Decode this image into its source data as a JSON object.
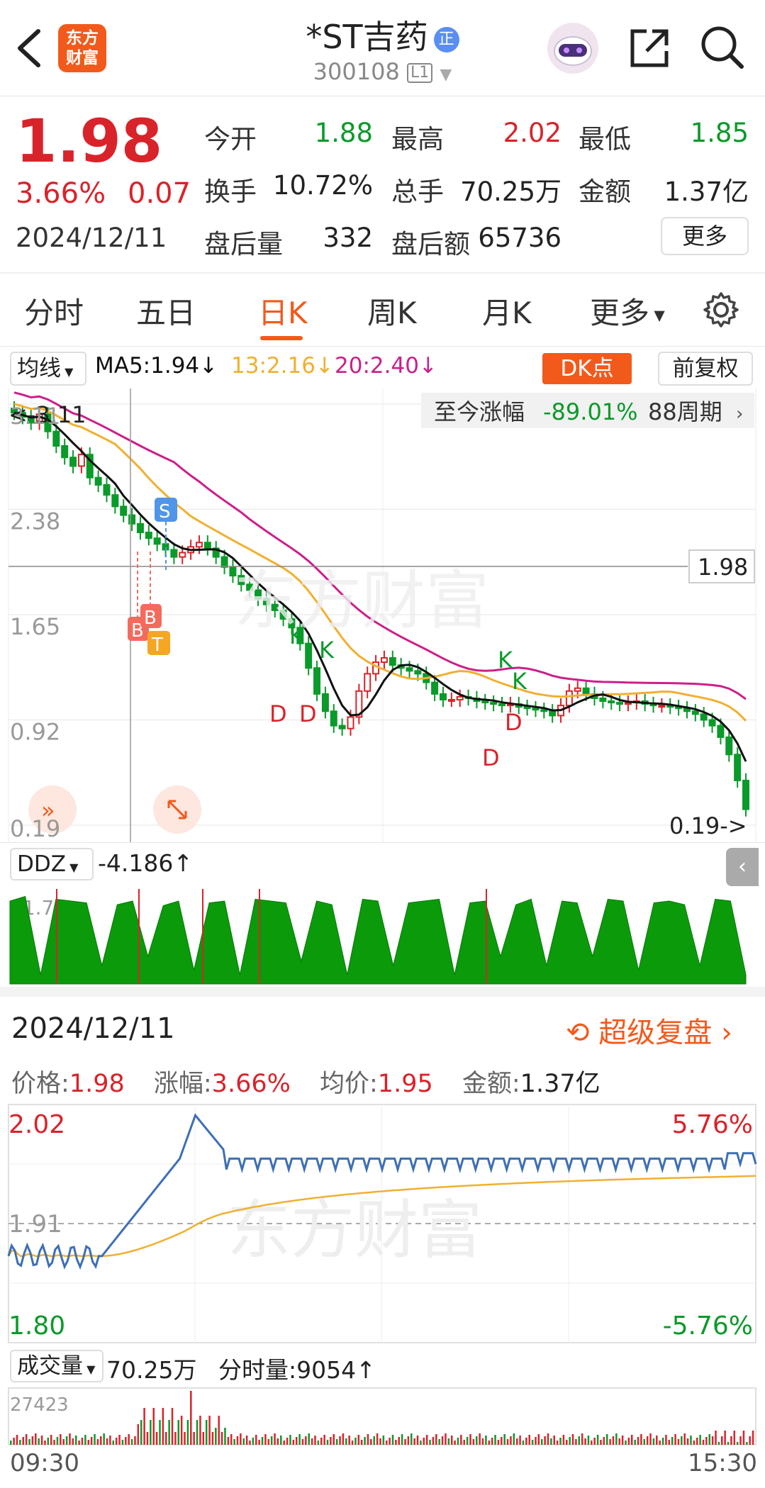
{
  "header": {
    "logo_text_line1": "东方",
    "logo_text_line2": "财富",
    "stock_name": "*ST吉药",
    "zheng_badge": "正",
    "stock_code": "300108",
    "level_badge": "L1"
  },
  "quote": {
    "price": "1.98",
    "change_pct": "3.66%",
    "change_amt": "0.07",
    "date": "2024/12/11",
    "open_label": "今开",
    "open": "1.88",
    "high_label": "最高",
    "high": "2.02",
    "low_label": "最低",
    "low": "1.85",
    "turnover_label": "换手",
    "turnover": "10.72%",
    "volume_label": "总手",
    "volume": "70.25万",
    "amount_label": "金额",
    "amount": "1.37亿",
    "after_vol_label": "盘后量",
    "after_vol": "332",
    "after_amt_label": "盘后额",
    "after_amt": "65736",
    "more_label": "更多"
  },
  "tabs": [
    "分时",
    "五日",
    "日K",
    "周K",
    "月K",
    "更多"
  ],
  "active_tab": "日K",
  "indicator_bar": {
    "ma_select": "均线",
    "ma5": "MA5:1.94↓",
    "ma13": "13:2.16↓",
    "ma20": "20:2.40↓",
    "dk_label": "DK点",
    "fq_label": "前复权"
  },
  "kline": {
    "since_label": "至今涨幅",
    "since_value": "-89.01%",
    "periods": "88周期",
    "y_ticks": [
      "3.11",
      "2.38",
      "1.65",
      "0.92",
      "0.19"
    ],
    "max_marker": "<-3.11",
    "min_marker": "0.19->",
    "current_price_tag": "1.98",
    "signals": {
      "S": "S",
      "B": "B",
      "T": "T",
      "K": "K",
      "D": "D"
    },
    "colors": {
      "up": "#d9232a",
      "down": "#0a9a2a",
      "ma5": "#111111",
      "ma13": "#f0b030",
      "ma20": "#cc1f8a"
    }
  },
  "ddz": {
    "select": "DDZ",
    "value": "-4.186↑",
    "top_label": "11.70"
  },
  "review": {
    "date": "2024/12/11",
    "super_review": "超级复盘",
    "price_label": "价格:",
    "price": "1.98",
    "pct_label": "涨幅:",
    "pct": "3.66%",
    "avg_label": "均价:",
    "avg": "1.95",
    "amt_label": "金额:",
    "amt": "1.37亿"
  },
  "intraday": {
    "high": "2.02",
    "mid": "1.91",
    "low": "1.80",
    "pct_high": "5.76%",
    "pct_low": "-5.76%"
  },
  "volume_bar": {
    "select": "成交量",
    "total": "70.25万",
    "minute_label": "分时量:9054↑",
    "max_label": "27423",
    "time_start": "09:30",
    "time_end": "15:30"
  }
}
